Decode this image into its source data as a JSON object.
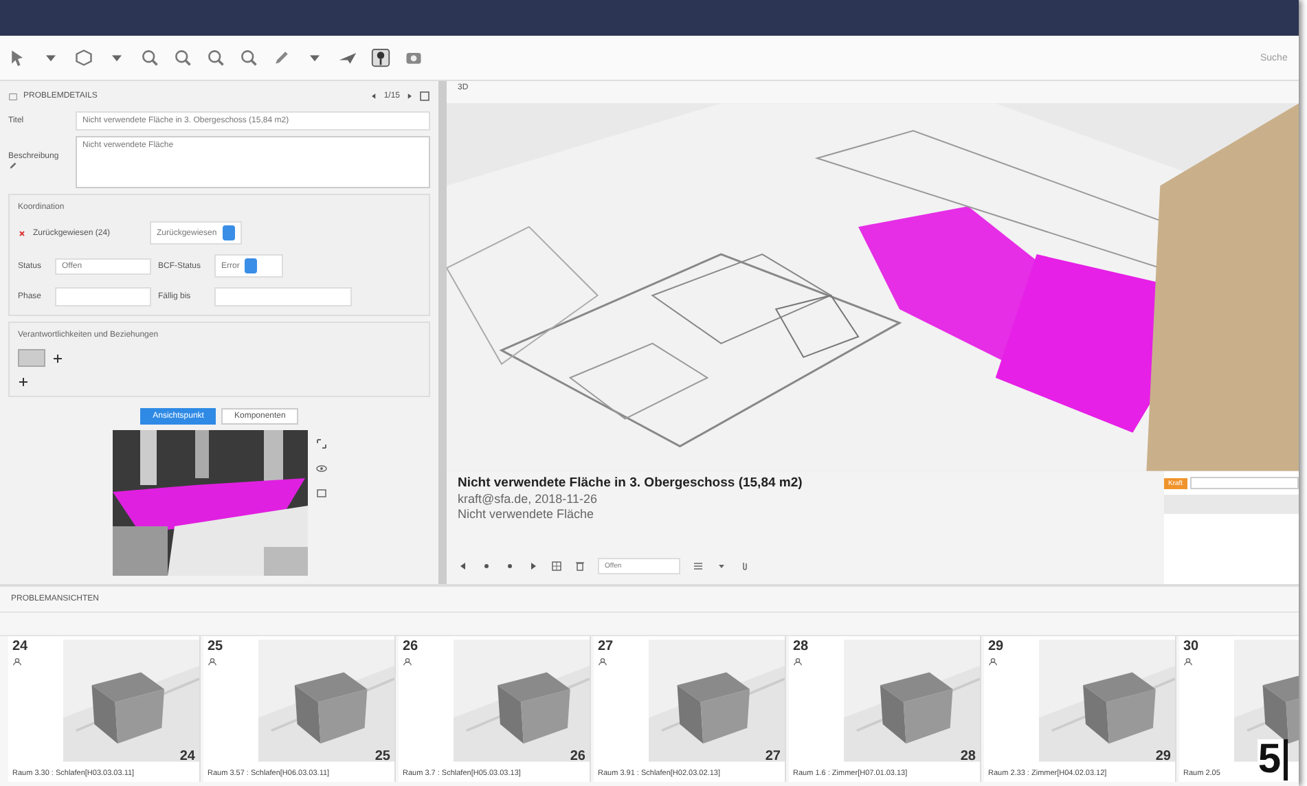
{
  "window": {
    "search_placeholder": "Suche"
  },
  "problem_details": {
    "title": "PROBLEMDETAILS",
    "counter": "1/15",
    "title_label": "Titel",
    "title_value": "Nicht verwendete Fläche in 3. Obergeschoss (15,84 m2)",
    "description_label": "Beschreibung",
    "description": "Nicht verwendete Fläche",
    "coordination": {
      "legend": "Koordination",
      "rejected": "Zurückgewiesen (24)",
      "rejected_choice": "Zurückgewiesen",
      "status_label": "Status",
      "status": "Offen",
      "bcf_label": "BCF-Status",
      "bcf": "Error",
      "phase_label": "Phase",
      "due_label": "Fällig bis"
    },
    "responsibilities": {
      "legend": "Verantwortlichkeiten und Beziehungen"
    },
    "tabs": [
      {
        "label": "Ansichtspunkt",
        "selected": true
      },
      {
        "label": "Komponenten",
        "selected": false
      }
    ]
  },
  "viewer": {
    "title": "3D",
    "issue_title": "Nicht verwendete Fläche in 3. Obergeschoss (15,84 m2)",
    "author_line": "kraft@sfa.de, 2018-11-26",
    "description": "Nicht verwendete Fläche",
    "status_choice": "Offen",
    "tag": "Kraft"
  },
  "problem_views": {
    "title": "PROBLEMANSICHTEN",
    "cards": [
      {
        "number": "24",
        "badge": "24",
        "caption": "Raum 3.30 : Schlafen[H03.03.03.11]"
      },
      {
        "number": "25",
        "badge": "25",
        "caption": "Raum 3.57 : Schlafen[H06.03.03.11]"
      },
      {
        "number": "26",
        "badge": "26",
        "caption": "Raum 3.7 : Schlafen[H05.03.03.13]"
      },
      {
        "number": "27",
        "badge": "27",
        "caption": "Raum 3.91 : Schlafen[H02.03.02.13]"
      },
      {
        "number": "28",
        "badge": "28",
        "caption": "Raum 1.6 : Zimmer[H07.01.03.13]"
      },
      {
        "number": "29",
        "badge": "29",
        "caption": "Raum 2.33 : Zimmer[H04.02.03.12]"
      },
      {
        "number": "30",
        "caption": "Raum 2.05"
      }
    ]
  },
  "page_number": "5"
}
